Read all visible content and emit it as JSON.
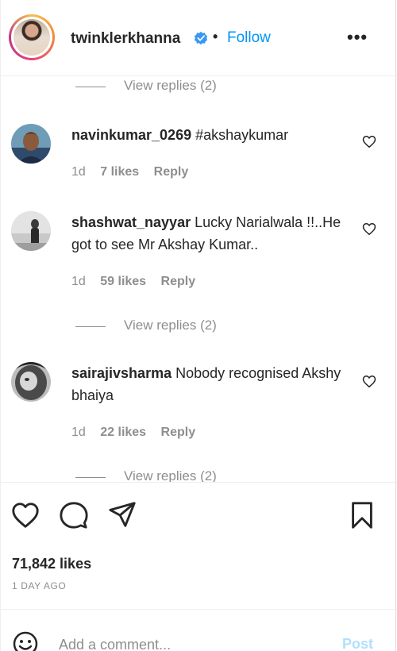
{
  "header": {
    "username": "twinklerkhanna",
    "separator": "•",
    "follow_label": "Follow",
    "more_label": "•••",
    "verified_color": "#3897f0",
    "follow_color": "#0095f6"
  },
  "comments": [
    {
      "username": "navinkumar_0269",
      "text": "#akshaykumar",
      "time": "1d",
      "likes": "7 likes",
      "reply_label": "Reply"
    },
    {
      "username": "shashwat_nayyar",
      "text": "Lucky Narialwala !!..He got to see Mr Akshay Kumar..",
      "time": "1d",
      "likes": "59 likes",
      "reply_label": "Reply"
    },
    {
      "username": "sairajivsharma",
      "text": "Nobody recognised Akshy bhaiya",
      "time": "1d",
      "likes": "22 likes",
      "reply_label": "Reply"
    }
  ],
  "view_replies": [
    "View replies (2)",
    "View replies (2)",
    "View replies (2)"
  ],
  "actions": {
    "like_icon": "heart-icon",
    "comment_icon": "comment-bubble-icon",
    "share_icon": "paper-plane-icon",
    "save_icon": "bookmark-icon"
  },
  "post": {
    "likes": "71,842 likes",
    "time_ago": "1 DAY AGO"
  },
  "add_comment": {
    "placeholder": "Add a comment...",
    "post_label": "Post",
    "post_color": "#b2dffc"
  }
}
